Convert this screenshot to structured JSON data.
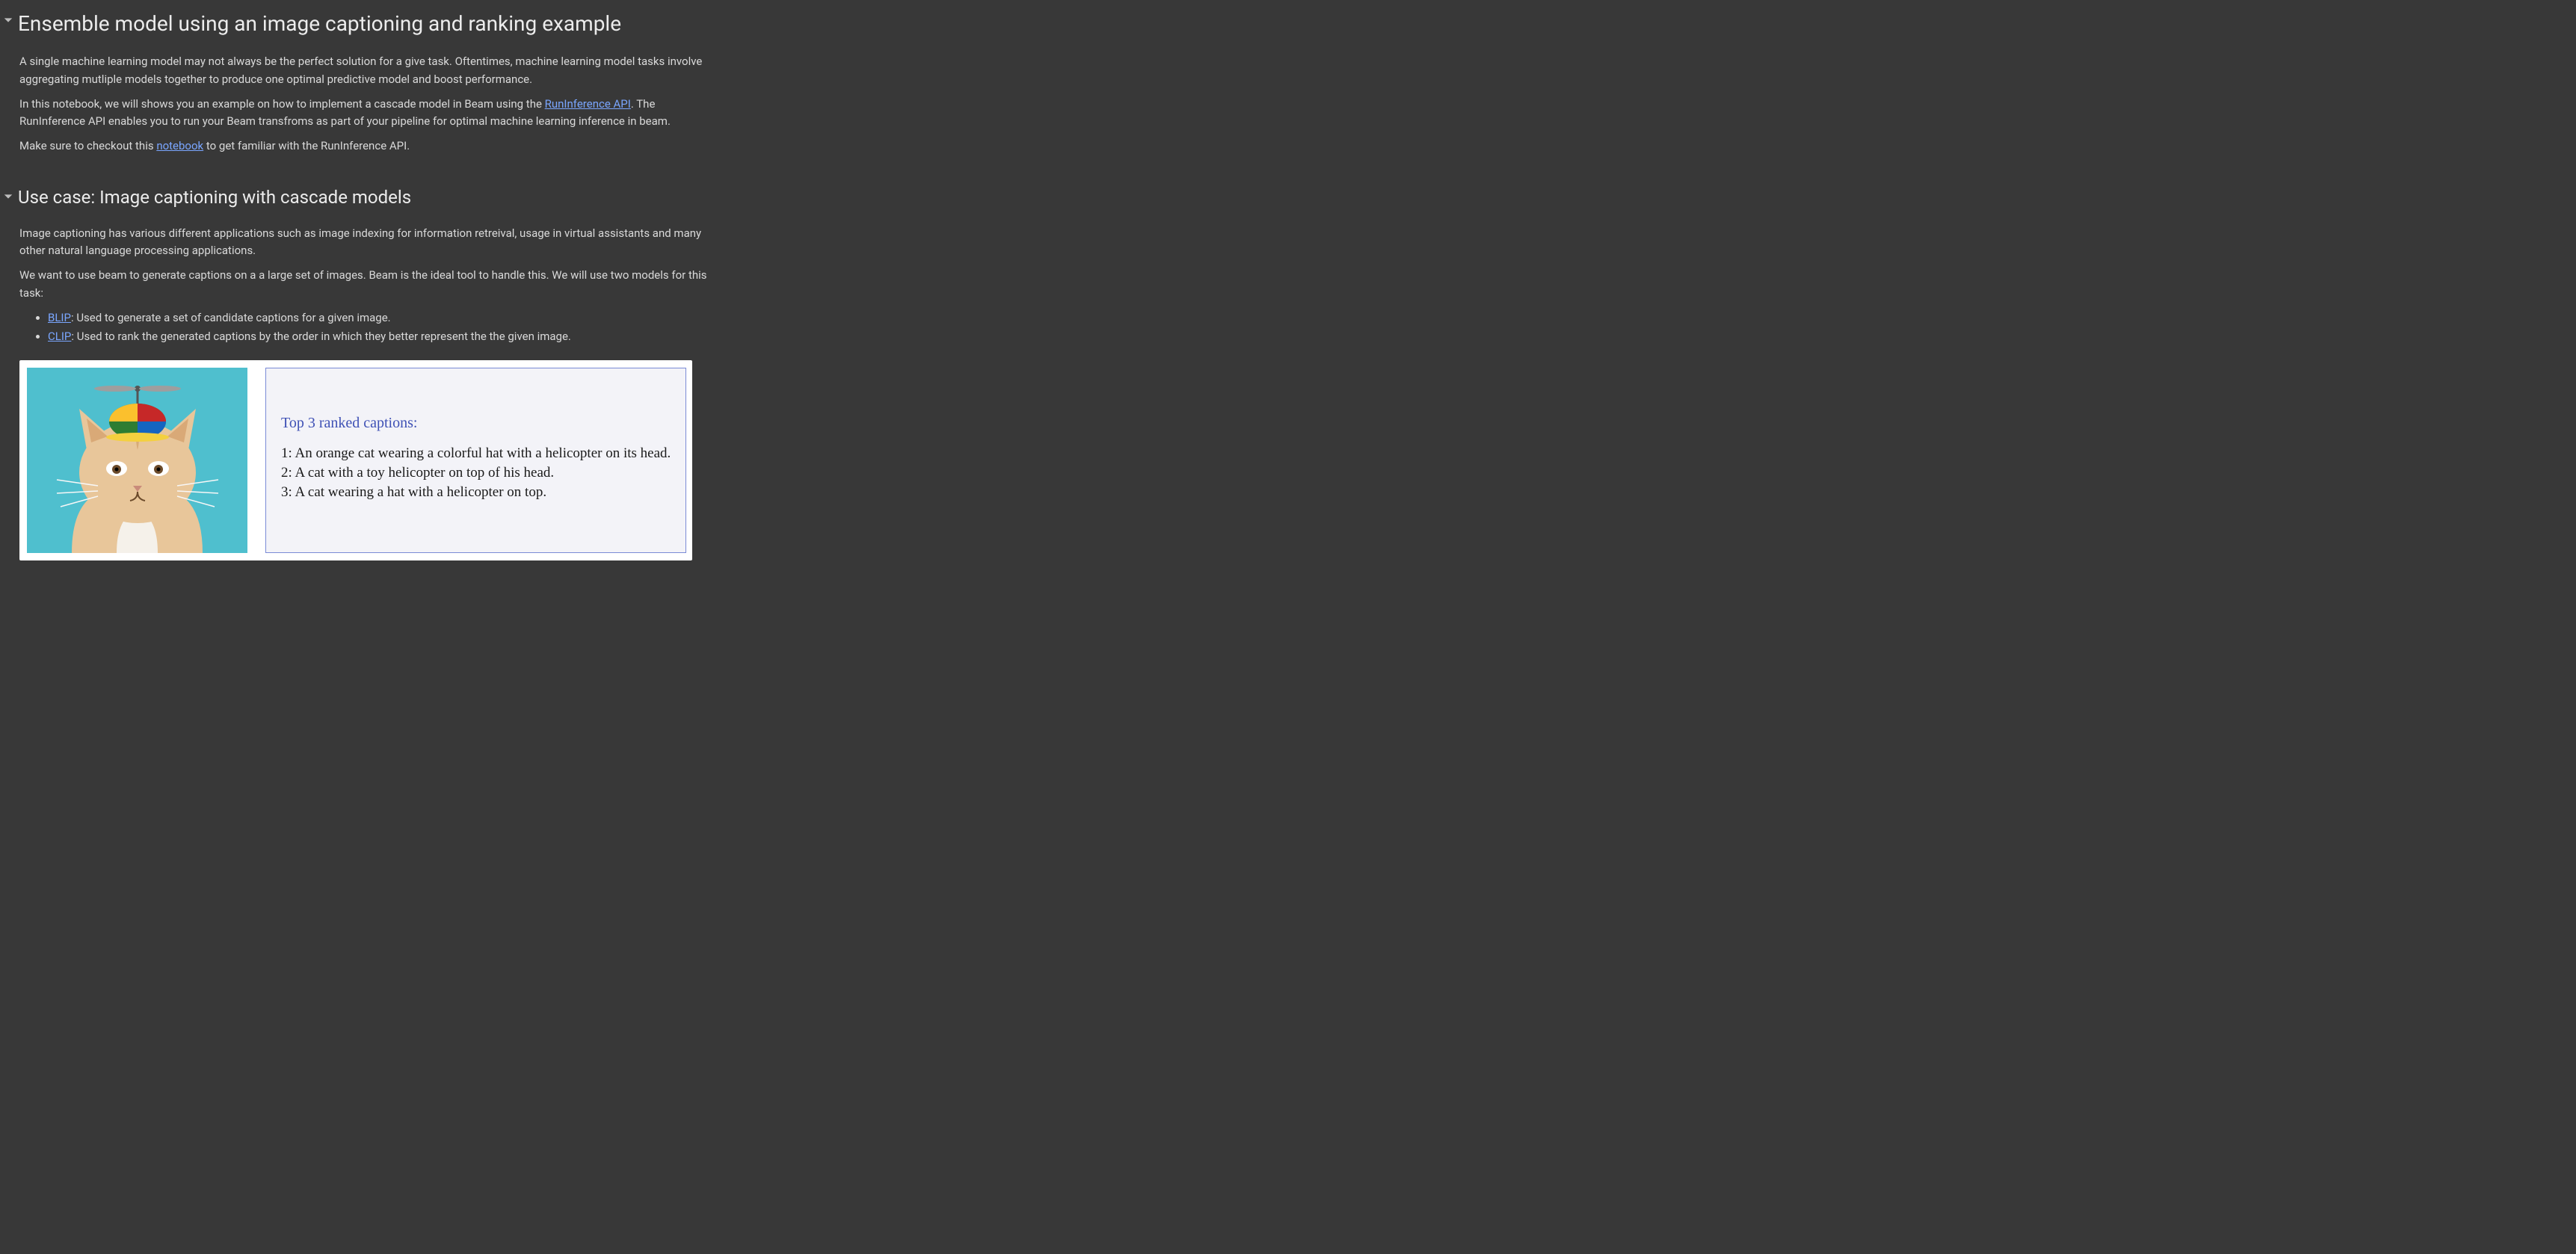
{
  "section1": {
    "title": "Ensemble model using an image captioning and ranking example",
    "p1": "A single machine learning model may not always be the perfect solution for a give task. Oftentimes, machine learning model tasks involve aggregating mutliple models together to produce one optimal predictive model and boost performance.",
    "p2_a": "In this notebook, we will shows you an example on how to implement a cascade model in Beam using the ",
    "p2_link": "RunInference API",
    "p2_b": ". The RunInference API enables you to run your Beam transfroms as part of your pipeline for optimal machine learning inference in beam.",
    "p3_a": "Make sure to checkout this ",
    "p3_link": "notebook",
    "p3_b": " to get familiar with the RunInference API."
  },
  "section2": {
    "title": "Use case: Image captioning with cascade models",
    "p1": "Image captioning has various different applications such as image indexing for information retreival, usage in virtual assistants and many other natural language processing applications.",
    "p2": "We want to use beam to generate captions on a a large set of images. Beam is the ideal tool to handle this. We will use two models for this task:",
    "li1_link": "BLIP",
    "li1_rest": ": Used to generate a set of candidate captions for a given image.",
    "li2_link": "CLIP",
    "li2_rest": ": Used to rank the generated captions by the order in which they better represent the the given image."
  },
  "figure": {
    "title": "Top 3 ranked captions:",
    "captions": {
      "c1": "1: An orange cat wearing a colorful hat with a helicopter on its head.",
      "c2": "2: A cat with a toy helicopter on top of his head.",
      "c3": "3: A cat wearing a hat with a helicopter on top."
    }
  }
}
